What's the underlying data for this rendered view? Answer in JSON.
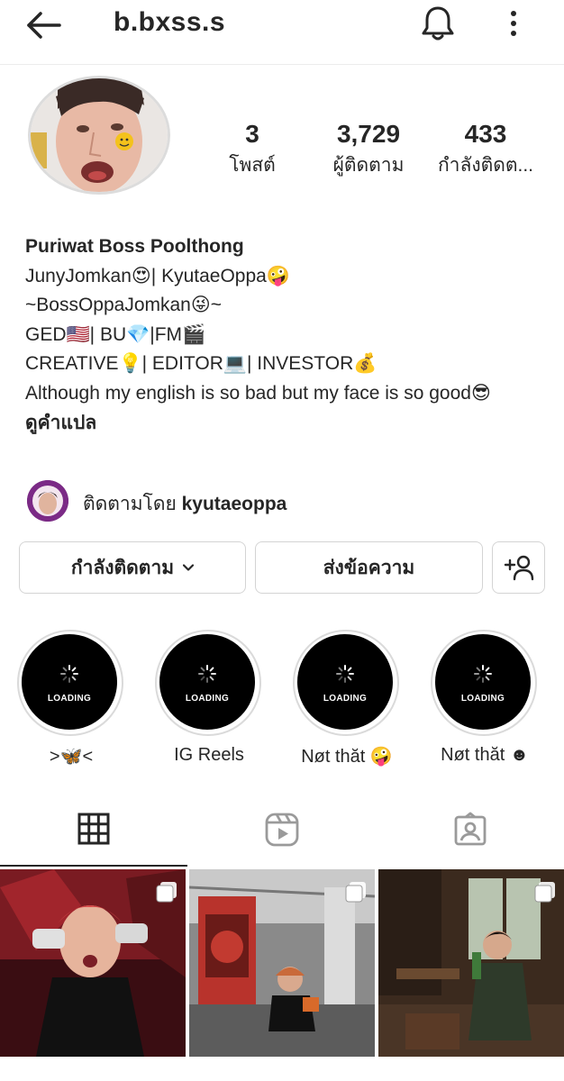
{
  "header": {
    "username": "b.bxss.s",
    "back_icon": "arrow-left-icon",
    "bell_icon": "bell-icon",
    "more_icon": "more-vertical-icon"
  },
  "stats": {
    "posts": {
      "value": "3",
      "label": "โพสต์"
    },
    "followers": {
      "value": "3,729",
      "label": "ผู้ติดตาม"
    },
    "following": {
      "value": "433",
      "label": "กำลังติดต..."
    }
  },
  "bio": {
    "name": "Puriwat Boss Poolthong",
    "lines": [
      "JunyJomkan😍| KyutaeOppa🤪",
      "~BossOppaJomkan😜~",
      "GED🇺🇸| BU💎|FM🎬",
      "CREATIVE💡| EDITOR💻| INVESTOR💰",
      "Although my english is so bad but my face is so good😎"
    ],
    "translate": "ดูคำแปล"
  },
  "followed_by": {
    "prefix": "ติดตามโดย",
    "user": "kyutaeoppa"
  },
  "actions": {
    "following_label": "กำลังติดตาม",
    "message_label": "ส่งข้อความ",
    "add_user_icon": "add-user-icon"
  },
  "highlights": [
    {
      "caption": ">🦋<",
      "loading": "LOADING"
    },
    {
      "caption": "IG Reels",
      "loading": "LOADING"
    },
    {
      "caption": "Nøt thăt 🤪",
      "loading": "LOADING"
    },
    {
      "caption": "Nøt thăt ☻",
      "loading": "LOADING"
    }
  ],
  "tabs": [
    {
      "name": "grid",
      "icon": "grid-icon",
      "active": true
    },
    {
      "name": "reels",
      "icon": "reels-icon",
      "active": false
    },
    {
      "name": "tagged",
      "icon": "tagged-icon",
      "active": false
    }
  ],
  "posts": [
    {
      "icon": "multiple-posts-icon"
    },
    {
      "icon": "multiple-posts-icon"
    },
    {
      "icon": "multiple-posts-icon"
    }
  ],
  "colors": {
    "text": "#262626",
    "border": "#d4d4d4",
    "highlight_bg": "#000000"
  }
}
